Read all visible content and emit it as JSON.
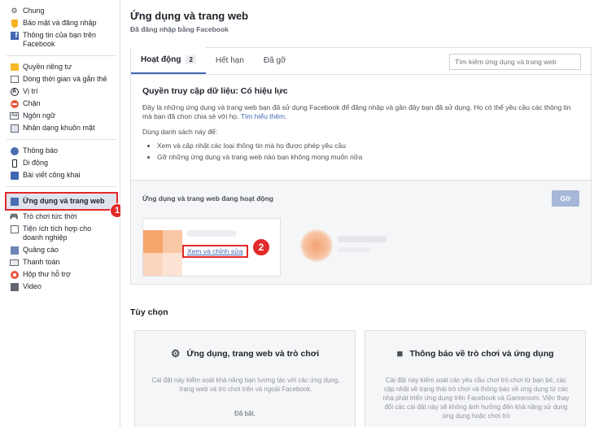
{
  "sidebar": {
    "groups": [
      [
        {
          "label": "Chung",
          "icon": "gears-icon"
        },
        {
          "label": "Bảo mật và đăng nhập",
          "icon": "shield-icon"
        },
        {
          "label": "Thông tin của bạn trên Facebook",
          "icon": "facebook-icon"
        }
      ],
      [
        {
          "label": "Quyền riêng tư",
          "icon": "privacy-icon"
        },
        {
          "label": "Dòng thời gian và gắn thẻ",
          "icon": "timeline-icon"
        },
        {
          "label": "Vị trí",
          "icon": "location-icon"
        },
        {
          "label": "Chặn",
          "icon": "block-icon"
        },
        {
          "label": "Ngôn ngữ",
          "icon": "language-icon"
        },
        {
          "label": "Nhận dạng khuôn mặt",
          "icon": "face-icon"
        }
      ],
      [
        {
          "label": "Thông báo",
          "icon": "globe-icon"
        },
        {
          "label": "Di động",
          "icon": "mobile-icon"
        },
        {
          "label": "Bài viết công khai",
          "icon": "rss-icon"
        }
      ],
      [
        {
          "label": "Ứng dụng và trang web",
          "icon": "apps-icon",
          "active": true
        },
        {
          "label": "Trò chơi tức thời",
          "icon": "gamepad-icon"
        },
        {
          "label": "Tiện ích tích hợp cho doanh nghiệp",
          "icon": "integration-icon"
        },
        {
          "label": "Quảng cáo",
          "icon": "ads-icon"
        },
        {
          "label": "Thanh toán",
          "icon": "payment-icon"
        },
        {
          "label": "Hộp thư hỗ trợ",
          "icon": "support-icon"
        },
        {
          "label": "Video",
          "icon": "video-icon"
        }
      ]
    ]
  },
  "annotations": {
    "one": "1",
    "two": "2"
  },
  "header": {
    "title": "Ứng dụng và trang web",
    "subtitle": "Đã đăng nhập bằng Facebook"
  },
  "tabs": [
    {
      "label": "Hoạt động",
      "count": "2",
      "active": true
    },
    {
      "label": "Hết hạn"
    },
    {
      "label": "Đã gỡ"
    }
  ],
  "search": {
    "placeholder": "Tìm kiếm ứng dụng và trang web"
  },
  "access": {
    "title": "Quyền truy cập dữ liệu: Có hiệu lực",
    "description": "Đây là những ứng dụng và trang web bạn đã sử dụng Facebook để đăng nhập và gần đây bạn đã sử dụng. Họ có thể yêu cầu các thông tin mà bạn đã chọn chia sẻ với họ.",
    "learn_more": "Tìm hiểu thêm.",
    "use_label": "Dùng danh sách này để:",
    "bullets": [
      "Xem và cập nhật các loại thông tin mà họ được phép yêu cầu",
      "Gỡ những ứng dụng và trang web nào bạn không mong muốn nữa"
    ]
  },
  "active_apps": {
    "title": "Ứng dụng và trang web đang hoạt động",
    "remove_label": "Gỡ",
    "edit_label": "Xem và chỉnh sửa"
  },
  "options": {
    "title": "Tùy chọn",
    "cards": [
      {
        "title": "Ứng dụng, trang web và trò chơi",
        "icon": "gear-icon",
        "description": "Cài đặt này kiểm soát khả năng bạn tương tác với các ứng dụng, trang web và trò chơi trên và ngoài Facebook.",
        "state": "Đã bật."
      },
      {
        "title": "Thông báo về trò chơi và ứng dụng",
        "icon": "cube-icon",
        "description": "Cài đặt này kiểm soát các yêu cầu chơi trò chơi từ bạn bè, các cập nhật về trạng thái trò chơi và thông báo về ứng dụng từ các nhà phát triển ứng dụng trên Facebook và Gameroom. Việc thay đổi các cài đặt này sẽ không ảnh hưởng đến khả năng sử dụng ứng dụng hoặc chơi trò"
      }
    ]
  },
  "colors": {
    "accent": "#4267b2",
    "highlight": "#e22a2a"
  }
}
